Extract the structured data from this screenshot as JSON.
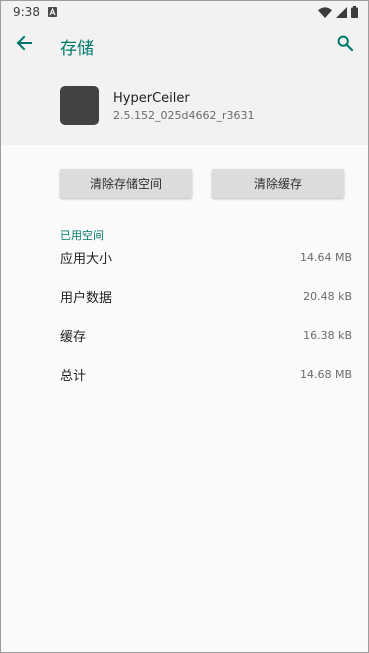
{
  "status_bar": {
    "time": "9:38",
    "notification_icon": "a-icon",
    "wifi_icon": "wifi-icon",
    "signal_icon": "signal-icon",
    "battery_icon": "battery-icon"
  },
  "toolbar": {
    "title": "存储",
    "back_icon": "arrow-back-icon",
    "search_icon": "search-icon"
  },
  "app": {
    "name": "HyperCeiler",
    "version": "2.5.152_025d4662_r3631"
  },
  "buttons": {
    "clear_storage": "清除存储空间",
    "clear_cache": "清除缓存"
  },
  "usage": {
    "section_title": "已用空间",
    "rows": [
      {
        "label": "应用大小",
        "value": "14.64 MB"
      },
      {
        "label": "用户数据",
        "value": "20.48 kB"
      },
      {
        "label": "缓存",
        "value": "16.38 kB"
      },
      {
        "label": "总计",
        "value": "14.68 MB"
      }
    ]
  },
  "colors": {
    "accent": "#00796b",
    "header_bg": "#f2f2f2",
    "page_bg": "#fafafa",
    "button_bg": "#dcdcdc"
  }
}
